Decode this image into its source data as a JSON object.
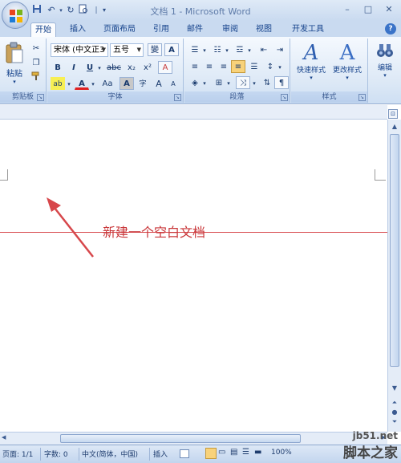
{
  "window": {
    "title": "文档 1 - Microsoft Word",
    "controls": {
      "minimize": "–",
      "maximize": "□",
      "close": "✕"
    }
  },
  "quick_access": {
    "save_icon": "save-icon",
    "undo_icon": "undo-icon",
    "redo_icon": "redo-icon",
    "print_preview_icon": "print-preview-icon",
    "customize_icon": "chevron-down-icon"
  },
  "tabs": [
    {
      "label": "开始",
      "active": true
    },
    {
      "label": "插入"
    },
    {
      "label": "页面布局"
    },
    {
      "label": "引用"
    },
    {
      "label": "邮件"
    },
    {
      "label": "审阅"
    },
    {
      "label": "视图"
    },
    {
      "label": "开发工具"
    }
  ],
  "help_label": "?",
  "ribbon": {
    "clipboard": {
      "label": "剪贴板",
      "paste_label": "粘贴"
    },
    "font": {
      "label": "字体",
      "font_name": "宋体 (中文正3",
      "font_size": "五号",
      "bold": "B",
      "italic": "I",
      "underline": "U",
      "strikethrough": "abc",
      "subscript": "x₂",
      "superscript": "x²",
      "clear_format": "A",
      "highlight": "ab",
      "font_color": "A",
      "change_case": "Aa",
      "char_shading": "A",
      "enclose": "字",
      "grow": "A",
      "shrink": "A",
      "phonetic": "變",
      "char_border": "A"
    },
    "paragraph": {
      "label": "段落"
    },
    "styles": {
      "label": "样式",
      "quick_styles": "快速样式",
      "change_styles": "更改样式"
    },
    "editing": {
      "label": "编辑"
    }
  },
  "document": {
    "annotation_text": "新建一个空白文档",
    "annotation_color": "#c9373a"
  },
  "status_bar": {
    "page": "页面: 1/1",
    "words": "字数: 0",
    "language": "中文(简体，中国)",
    "insert_mode": "插入",
    "zoom": "100%"
  },
  "watermark": {
    "site": "jb51.net",
    "name": "脚本之家"
  }
}
